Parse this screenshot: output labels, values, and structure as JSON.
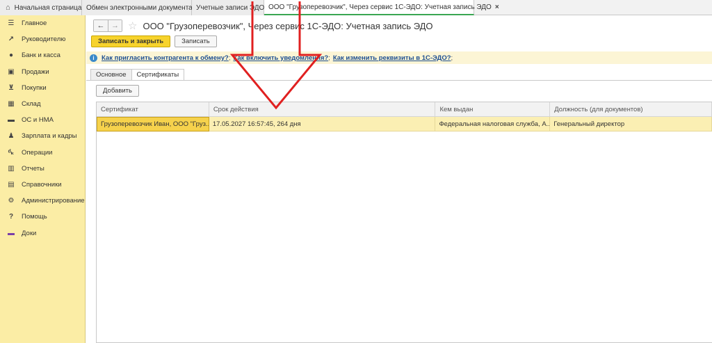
{
  "tabs": [
    {
      "label": "Начальная страница",
      "home": true
    },
    {
      "label": "Обмен электронными документами",
      "closable": true
    },
    {
      "label": "Учетные записи ЭДО",
      "closable": true
    },
    {
      "label": "ООО \"Грузоперевозчик\", Через сервис 1С-ЭДО: Учетная запись ЭДО",
      "closable": true,
      "active": true
    }
  ],
  "sidebar": {
    "items": [
      {
        "label": "Главное",
        "icon": "menu-icon"
      },
      {
        "label": "Руководителю",
        "icon": "trend-icon"
      },
      {
        "label": "Банк и касса",
        "icon": "coin-icon"
      },
      {
        "label": "Продажи",
        "icon": "bag-icon"
      },
      {
        "label": "Покупки",
        "icon": "cart-icon"
      },
      {
        "label": "Склад",
        "icon": "warehouse-icon"
      },
      {
        "label": "ОС и НМА",
        "icon": "truck-icon"
      },
      {
        "label": "Зарплата и кадры",
        "icon": "people-icon"
      },
      {
        "label": "Операции",
        "icon": "operations-icon"
      },
      {
        "label": "Отчеты",
        "icon": "bar-chart-icon"
      },
      {
        "label": "Справочники",
        "icon": "book-icon"
      },
      {
        "label": "Администрирование",
        "icon": "gear-icon"
      },
      {
        "label": "Помощь",
        "icon": "question-icon"
      },
      {
        "label": "Доки",
        "icon": "doc-icon"
      }
    ]
  },
  "header": {
    "title": "ООО \"Грузоперевозчик\", Через сервис 1С-ЭДО: Учетная запись ЭДО"
  },
  "toolbar": {
    "save_close": "Записать и закрыть",
    "save": "Записать"
  },
  "info": {
    "link1": "Как пригласить контрагента к обмену?",
    "link2": "Как включить уведомления?",
    "link3": "Как изменить реквизиты в 1С-ЭДО?",
    "sep": ";"
  },
  "form_tabs": {
    "main": "Основное",
    "certs": "Сертификаты"
  },
  "add_button": "Добавить",
  "table": {
    "columns": [
      "Сертификат",
      "Срок действия",
      "Кем выдан",
      "Должность (для документов)"
    ],
    "rows": [
      [
        "Грузоперевозчик Иван, ООО \"Груз...",
        "17.05.2027 16:57:45, 264 дня",
        "Федеральная налоговая служба, А...",
        "Генеральный директор"
      ]
    ]
  },
  "colors": {
    "sidebar_bg": "#fbeda5",
    "primary_button": "#f7d32c",
    "active_tab_underline": "#3aa652",
    "annotation_arrow": "#e02020"
  }
}
